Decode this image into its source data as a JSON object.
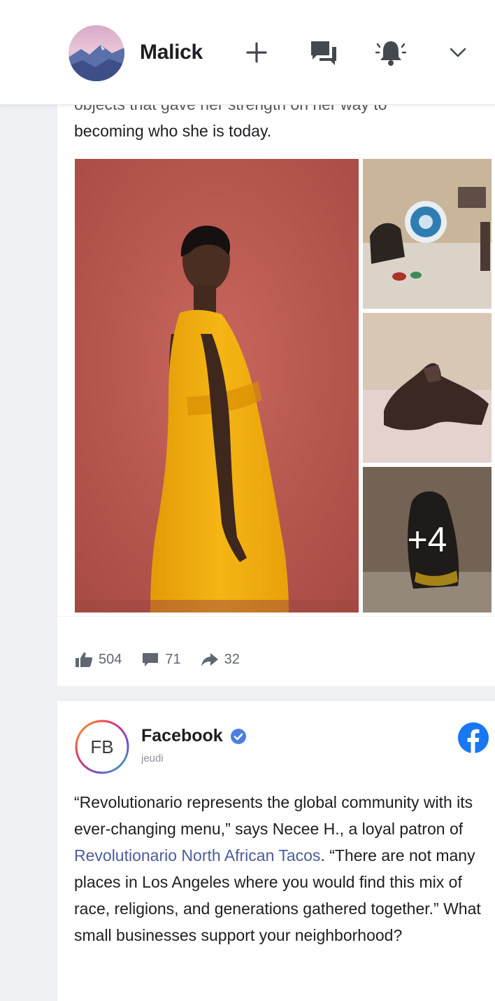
{
  "header": {
    "username": "Malick",
    "icons": [
      "plus-icon",
      "chat-icon",
      "bell-icon",
      "chevron-down-icon"
    ]
  },
  "post1": {
    "cut_line": "objects that gave her strength on her way to",
    "text": "becoming who she is today.",
    "more_photos": "+4",
    "stats": {
      "likes": "504",
      "comments": "71",
      "shares": "32"
    }
  },
  "post2": {
    "avatar_text": "FB",
    "author": "Facebook",
    "date": "jeudi",
    "text_before_link": "“Revolutionario represents the global community with its ever-changing menu,” says Necee H., a loyal patron of ",
    "link": "Revolutionario North African Tacos",
    "text_after_link": ". “There are not many places in Los Angeles where you would find this mix of race, religions, and generations gathered together.” What small businesses support your neighborhood?"
  },
  "colors": {
    "brand": "#1877f2",
    "link": "#4a5d9a",
    "muted": "#606770"
  }
}
